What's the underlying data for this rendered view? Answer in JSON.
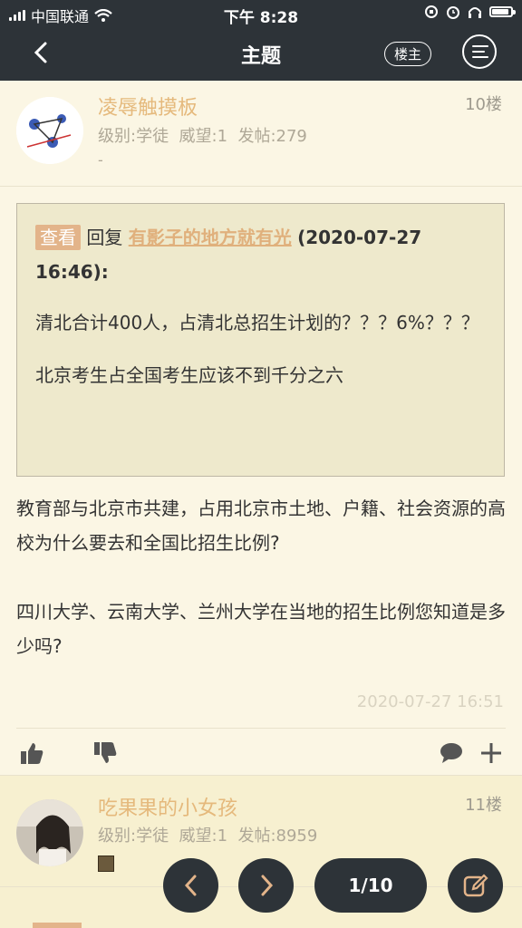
{
  "status_bar": {
    "carrier": "中国联通",
    "time": "下午 8:28"
  },
  "nav": {
    "title": "主题",
    "op_label": "楼主"
  },
  "posts": [
    {
      "username": "凌辱触摸板",
      "floor": "10楼",
      "meta": "级别:学徒  威望:1  发帖:279",
      "signature": "-",
      "quote": {
        "tag": "查看",
        "reply_word": "回复",
        "author": "有影子的地方就有光",
        "date": "(2020-07-27 16:46):",
        "line1": "清北合计400人，占清北总招生计划的？？？6%？？？",
        "line2": "北京考生占全国考生应该不到千分之六"
      },
      "body1": "教育部与北京市共建，占用北京市土地、户籍、社会资源的高校为什么要去和全国比招生比例?",
      "body2": "四川大学、云南大学、兰州大学在当地的招生比例您知道是多少吗?",
      "time": "2020-07-27 16:51"
    },
    {
      "username": "吃果果的小女孩",
      "floor": "11楼",
      "meta": "级别:学徒  威望:1  发帖:8959"
    }
  ],
  "pager": {
    "label": "1/10"
  },
  "colors": {
    "header_bg": "#2D3338",
    "page_bg": "#FBF6E4",
    "accent": "#E5B97C"
  }
}
